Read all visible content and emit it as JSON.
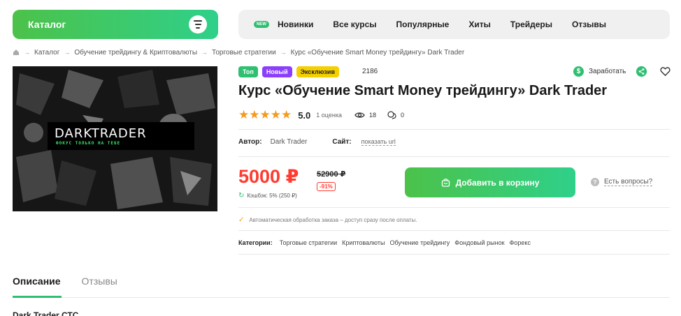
{
  "header": {
    "catalog_label": "Каталог",
    "catalog_icon": "filter-icon",
    "nav_badge": "NEW",
    "nav": [
      "Новинки",
      "Все курсы",
      "Популярные",
      "Хиты",
      "Трейдеры",
      "Отзывы"
    ]
  },
  "breadcrumb": {
    "home_icon": "home-icon",
    "items": [
      "Каталог",
      "Обучение трейдингу & Криптовалюты",
      "Торговые стратегии",
      "Курс «Обучение Smart Money трейдингу» Dark Trader"
    ]
  },
  "product": {
    "image_logo": "DARKTRADER",
    "image_tagline": "ФОКУС ТОЛЬКО НА ТЕБЕ",
    "badges": [
      "Топ",
      "Новый",
      "Эксклюзив"
    ],
    "views_top": "2186",
    "earn_label": "Заработать",
    "title": "Курс «Обучение Smart Money трейдингу» Dark Trader",
    "rating_stars": "★★★★★",
    "rating_value": "5.0",
    "rating_count": "1 оценка",
    "views": "18",
    "comments": "0",
    "author_label": "Автор:",
    "author_value": "Dark Trader",
    "site_label": "Сайт:",
    "site_link": "показать url",
    "price": "5000 ₽",
    "old_price": "52900 ₽",
    "discount": "-91%",
    "cashback": "Кэшбэк: 5% (250 ₽)",
    "cart_button": "Добавить в корзину",
    "questions_label": "Есть вопросы?",
    "auto_processing": "Автоматическая обработка заказа – доступ сразу после оплаты.",
    "categories_label": "Категории:",
    "categories": [
      "Торговые стратегии",
      "Криптовалюты",
      "Обучение трейдингу",
      "Фондовый рынок",
      "Форекс"
    ]
  },
  "tabs": [
    "Описание",
    "Отзывы"
  ],
  "bottom_text": "Dark Trader СТС",
  "colors": {
    "accent_green": "#2fbf71",
    "price_red": "#ff3b30",
    "star_orange": "#f39a1f",
    "badge_purple": "#8a3ffc",
    "badge_yellow": "#f5d000"
  }
}
